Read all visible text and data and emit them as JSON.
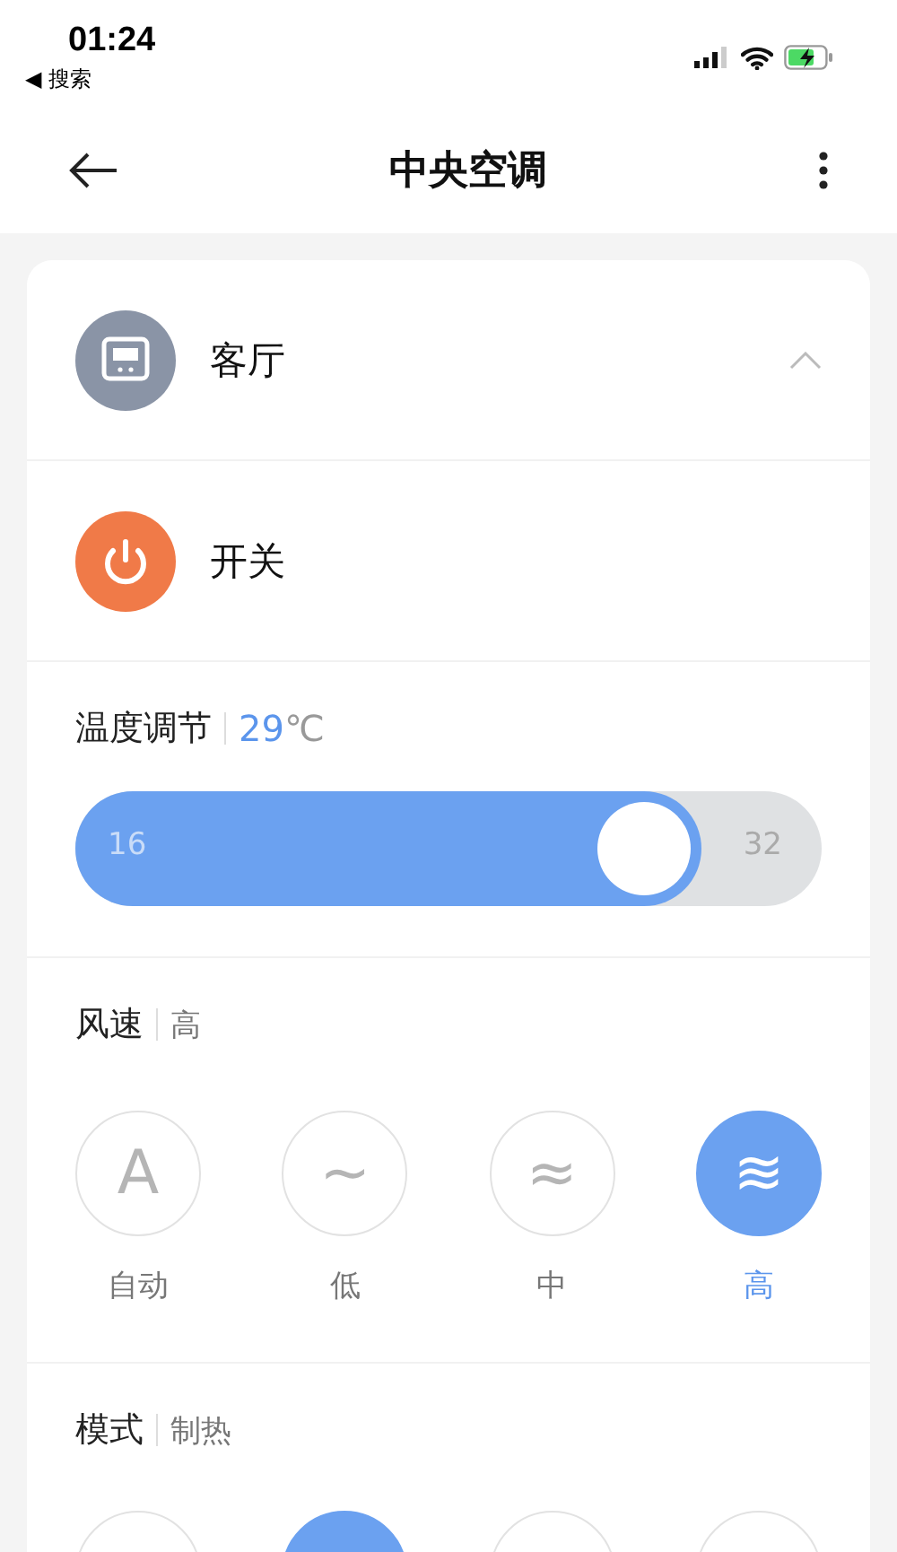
{
  "status_bar": {
    "time": "01:24",
    "back_label": "◀ 搜索"
  },
  "header": {
    "title": "中央空调"
  },
  "room": {
    "name": "客厅",
    "expanded": true
  },
  "power": {
    "label": "开关",
    "on": true
  },
  "temperature": {
    "label": "温度调节",
    "value": "29",
    "unit": "℃",
    "min": "16",
    "max": "32",
    "level": 0.84
  },
  "fan": {
    "label": "风速",
    "value": "高",
    "options": [
      {
        "glyph": "A",
        "label": "自动",
        "selected": false
      },
      {
        "glyph": "~",
        "label": "低",
        "selected": false
      },
      {
        "glyph": "≈",
        "label": "中",
        "selected": false
      },
      {
        "glyph": "≋",
        "label": "高",
        "selected": true
      }
    ]
  },
  "mode": {
    "label": "模式",
    "value": "制热",
    "options": [
      {
        "selected": false
      },
      {
        "selected": true
      },
      {
        "selected": false
      },
      {
        "selected": false
      }
    ]
  }
}
